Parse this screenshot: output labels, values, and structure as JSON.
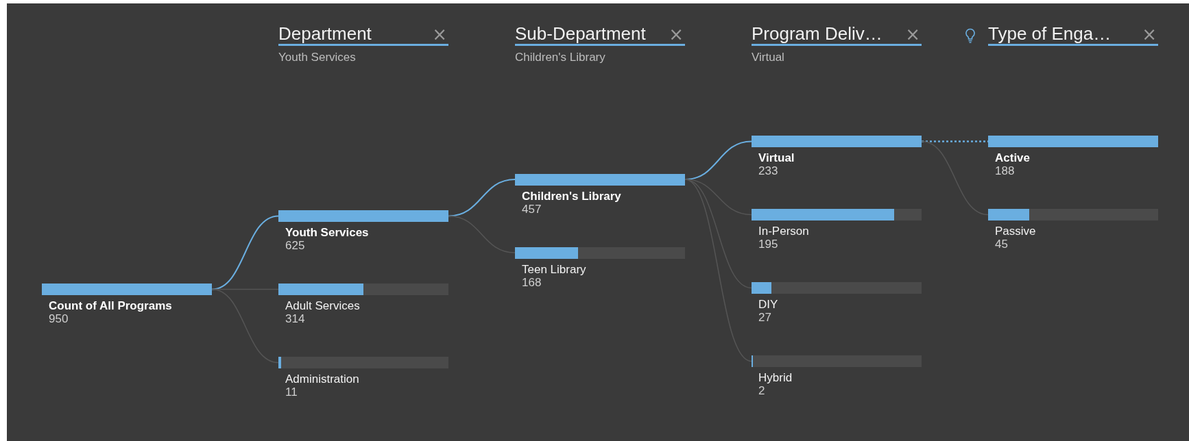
{
  "root": {
    "label": "Count of All Programs",
    "value": "950",
    "level": 1,
    "selected": true
  },
  "columns": [
    {
      "title": "Department",
      "close": "×",
      "subtitle": "Youth Services",
      "ai_split": false,
      "nodes": [
        {
          "label": "Youth Services",
          "value": "625",
          "level": 1,
          "selected": true
        },
        {
          "label": "Adult Services",
          "value": "314",
          "level": 0.5,
          "selected": false
        },
        {
          "label": "Administration",
          "value": "11",
          "level": 0.018,
          "selected": false
        }
      ]
    },
    {
      "title": "Sub-Department",
      "close": "×",
      "subtitle": "Children's Library",
      "ai_split": false,
      "nodes": [
        {
          "label": "Children's Library",
          "value": "457",
          "level": 1,
          "selected": true
        },
        {
          "label": "Teen Library",
          "value": "168",
          "level": 0.37,
          "selected": false
        }
      ]
    },
    {
      "title": "Program Deliv…",
      "close": "×",
      "subtitle": "Virtual",
      "ai_split": false,
      "nodes": [
        {
          "label": "Virtual",
          "value": "233",
          "level": 1,
          "selected": true
        },
        {
          "label": "In-Person",
          "value": "195",
          "level": 0.84,
          "selected": false
        },
        {
          "label": "DIY",
          "value": "27",
          "level": 0.116,
          "selected": false
        },
        {
          "label": "Hybrid",
          "value": "2",
          "level": 0.009,
          "selected": false
        }
      ]
    },
    {
      "title": "Type of Enga…",
      "close": "×",
      "ai_split": true,
      "nodes": [
        {
          "label": "Active",
          "value": "188",
          "level": 1,
          "selected": true
        },
        {
          "label": "Passive",
          "value": "45",
          "level": 0.24,
          "selected": false
        }
      ]
    }
  ]
}
